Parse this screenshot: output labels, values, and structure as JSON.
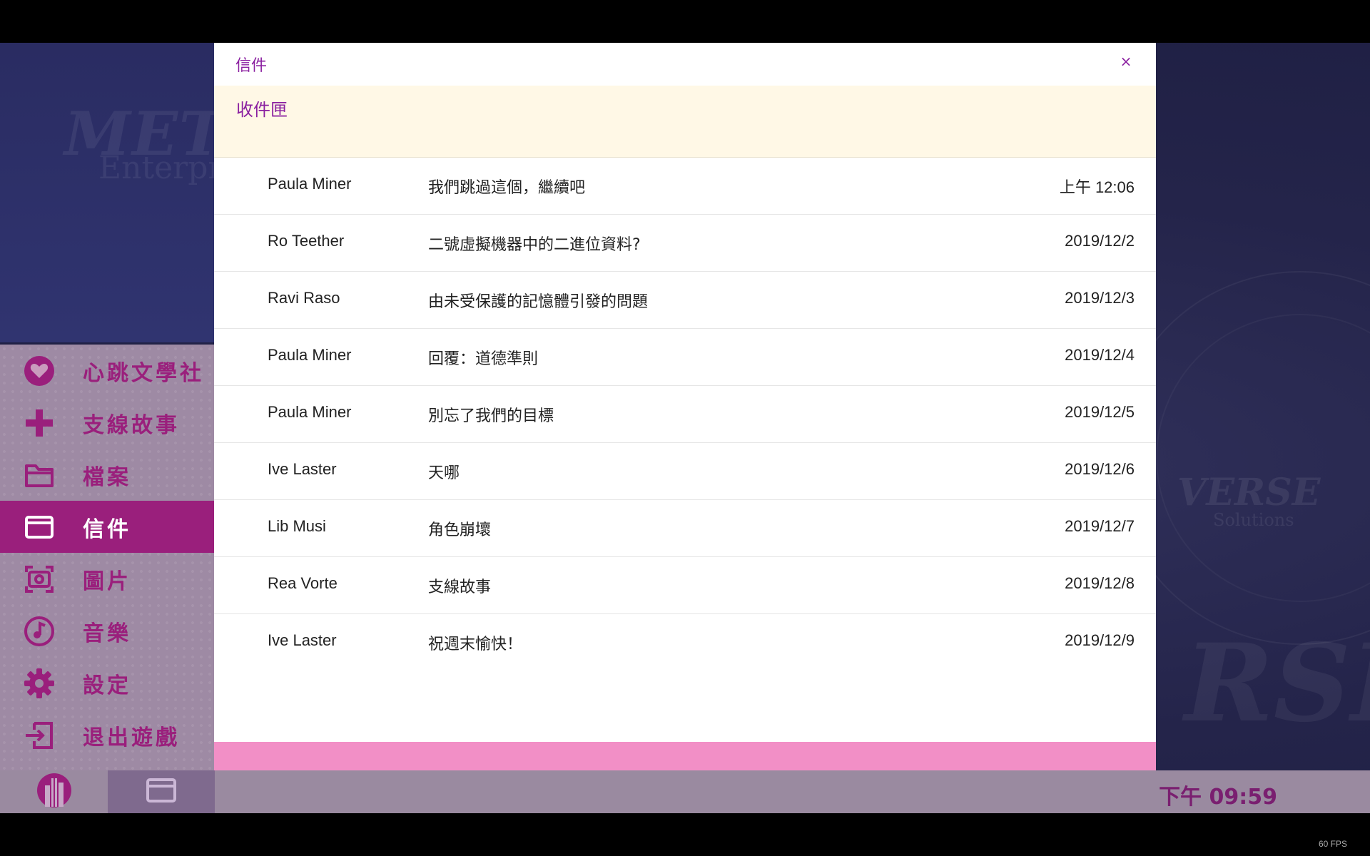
{
  "background": {
    "logo_top_main": "META",
    "logo_top_sub": "Enterpri",
    "logo_right_main": "VERSE",
    "logo_right_sub": "Solutions",
    "logo_right_large": "RSE"
  },
  "sidebar": {
    "items": [
      {
        "label": "心跳文學社",
        "icon": "heart-icon",
        "active": false
      },
      {
        "label": "支線故事",
        "icon": "plus-icon",
        "active": false
      },
      {
        "label": "檔案",
        "icon": "folder-icon",
        "active": false
      },
      {
        "label": "信件",
        "icon": "mail-icon",
        "active": true
      },
      {
        "label": "圖片",
        "icon": "camera-icon",
        "active": false
      },
      {
        "label": "音樂",
        "icon": "music-icon",
        "active": false
      },
      {
        "label": "設定",
        "icon": "gear-icon",
        "active": false
      },
      {
        "label": "退出遊戲",
        "icon": "exit-icon",
        "active": false
      }
    ]
  },
  "dialog": {
    "title": "信件",
    "close": "×",
    "folder": "收件匣",
    "messages": [
      {
        "from": "Paula Miner",
        "subject": "我們跳過這個，繼續吧",
        "date": "上午 12:06"
      },
      {
        "from": "Ro Teether",
        "subject": "二號虛擬機器中的二進位資料?",
        "date": "2019/12/2"
      },
      {
        "from": "Ravi Raso",
        "subject": "由未受保護的記憶體引發的問題",
        "date": "2019/12/3"
      },
      {
        "from": "Paula Miner",
        "subject": "回覆：道德準則",
        "date": "2019/12/4"
      },
      {
        "from": "Paula Miner",
        "subject": "別忘了我們的目標",
        "date": "2019/12/5"
      },
      {
        "from": "Ive Laster",
        "subject": "天哪",
        "date": "2019/12/6"
      },
      {
        "from": "Lib Musi",
        "subject": "角色崩壞",
        "date": "2019/12/7"
      },
      {
        "from": "Rea Vorte",
        "subject": "支線故事",
        "date": "2019/12/8"
      },
      {
        "from": "Ive Laster",
        "subject": "祝週末愉快！",
        "date": "2019/12/9"
      }
    ]
  },
  "taskbar": {
    "clock": "下午 09:59"
  },
  "fps": "60 FPS",
  "colors": {
    "accent": "#9a1f7c",
    "title_purple": "#8a1fa0",
    "footer_pink": "#f28fc6",
    "folder_bg": "#fff8e6"
  }
}
